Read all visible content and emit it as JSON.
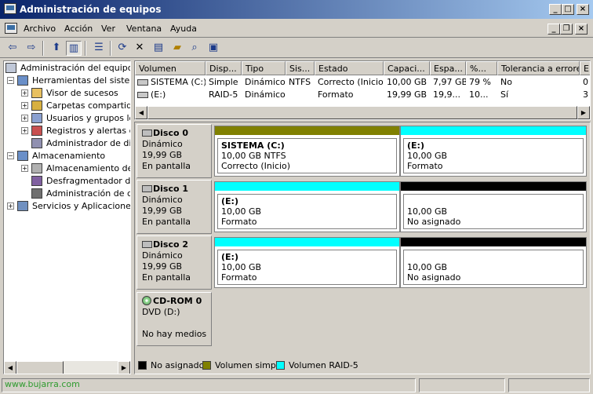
{
  "window": {
    "title": "Administración de equipos"
  },
  "menu": [
    "Archivo",
    "Acción",
    "Ver",
    "Ventana",
    "Ayuda"
  ],
  "tree": {
    "root": "Administración del equipo (local)",
    "items": [
      {
        "label": "Herramientas del sistema",
        "expander": "−",
        "level": 1
      },
      {
        "label": "Visor de sucesos",
        "expander": "+",
        "level": 2
      },
      {
        "label": "Carpetas compartidas",
        "expander": "+",
        "level": 2
      },
      {
        "label": "Usuarios y grupos locales",
        "expander": "+",
        "level": 2
      },
      {
        "label": "Registros y alertas de rendimiento",
        "expander": "+",
        "level": 2
      },
      {
        "label": "Administrador de dispositivos",
        "expander": "",
        "level": 2
      },
      {
        "label": "Almacenamiento",
        "expander": "−",
        "level": 1
      },
      {
        "label": "Almacenamiento de medios extraíbles",
        "expander": "+",
        "level": 2
      },
      {
        "label": "Desfragmentador de disco",
        "expander": "",
        "level": 2
      },
      {
        "label": "Administración de discos",
        "expander": "",
        "level": 2
      },
      {
        "label": "Servicios y Aplicaciones",
        "expander": "+",
        "level": 1
      }
    ]
  },
  "volumes": {
    "columns": [
      "Volumen",
      "Disp...",
      "Tipo",
      "Sis...",
      "Estado",
      "Capaci...",
      "Espa...",
      "%...",
      "Tolerancia a errores",
      "E"
    ],
    "rows": [
      [
        "SISTEMA (C:)",
        "Simple",
        "Dinámico",
        "NTFS",
        "Correcto (Inicio)",
        "10,00 GB",
        "7,97 GB",
        "79 %",
        "No",
        "0"
      ],
      [
        "(E:)",
        "RAID-5",
        "Dinámico",
        "",
        "Formato",
        "19,99 GB",
        "19,9...",
        "10...",
        "Sí",
        "3"
      ]
    ]
  },
  "disks": [
    {
      "name": "Disco 0",
      "type": "Dinámico",
      "size": "19,99 GB",
      "status": "En pantalla",
      "partitions": [
        {
          "name": "SISTEMA  (C:)",
          "line1": "10,00 GB NTFS",
          "line2": "Correcto (Inicio)",
          "kind": "simple"
        },
        {
          "name": "(E:)",
          "line1": "10,00 GB",
          "line2": "Formato",
          "kind": "raid"
        }
      ]
    },
    {
      "name": "Disco 1",
      "type": "Dinámico",
      "size": "19,99 GB",
      "status": "En pantalla",
      "partitions": [
        {
          "name": "(E:)",
          "line1": "10,00 GB",
          "line2": "Formato",
          "kind": "raid"
        },
        {
          "name": "",
          "line1": "10,00 GB",
          "line2": "No asignado",
          "kind": "unalloc"
        }
      ]
    },
    {
      "name": "Disco 2",
      "type": "Dinámico",
      "size": "19,99 GB",
      "status": "En pantalla",
      "partitions": [
        {
          "name": "(E:)",
          "line1": "10,00 GB",
          "line2": "Formato",
          "kind": "raid"
        },
        {
          "name": "",
          "line1": "10,00 GB",
          "line2": "No asignado",
          "kind": "unalloc"
        }
      ]
    }
  ],
  "cdrom": {
    "name": "CD-ROM 0",
    "type": "DVD (D:)",
    "status": "No hay medios"
  },
  "legend": [
    {
      "label": "No asignado",
      "color": "#000000"
    },
    {
      "label": "Volumen simple",
      "color": "#808000"
    },
    {
      "label": "Volumen RAID-5",
      "color": "#00ffff"
    }
  ],
  "colors": {
    "simple": "#808000",
    "raid": "#00ffff",
    "unalloc": "#000000"
  },
  "status": {
    "watermark": "www.bujarra.com"
  }
}
